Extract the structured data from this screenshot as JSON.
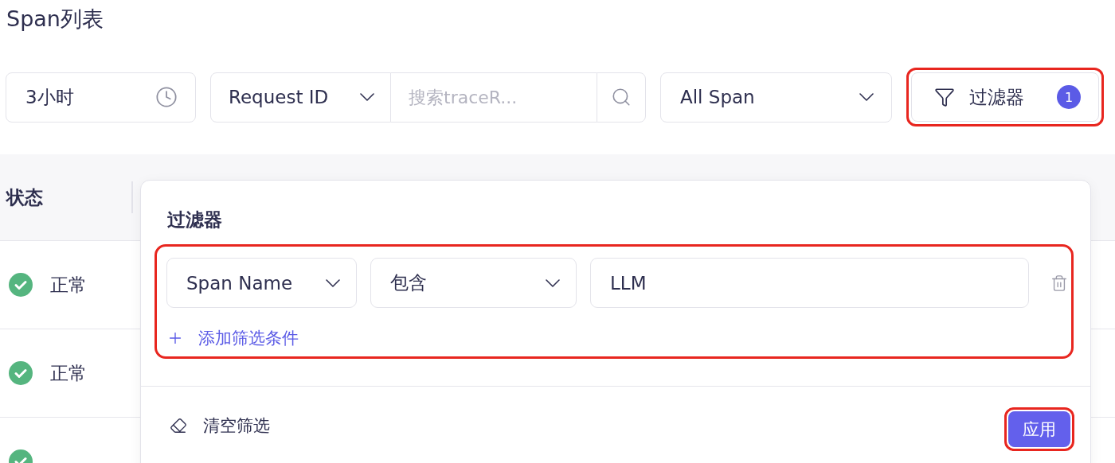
{
  "page_title": "Span列表",
  "toolbar": {
    "time_range": {
      "value": "3小时"
    },
    "search_type": {
      "value": "Request ID"
    },
    "search": {
      "placeholder": "搜索traceR..."
    },
    "span_filter": {
      "value": "All Span"
    },
    "filter_button": {
      "label": "过滤器",
      "badge": "1",
      "highlighted": true
    }
  },
  "table": {
    "columns": [
      "状态"
    ],
    "rows": [
      {
        "status": "正常",
        "kind": "ok"
      },
      {
        "status": "正常",
        "kind": "ok"
      },
      {
        "kind": "ok"
      }
    ]
  },
  "filter_popover": {
    "title": "过滤器",
    "conditions": [
      {
        "field": "Span Name",
        "operator": "包含",
        "value": "LLM"
      }
    ],
    "conditions_highlighted": true,
    "add_label": "添加筛选条件",
    "clear_label": "清空筛选",
    "apply_label": "应用",
    "apply_highlighted": true
  }
}
